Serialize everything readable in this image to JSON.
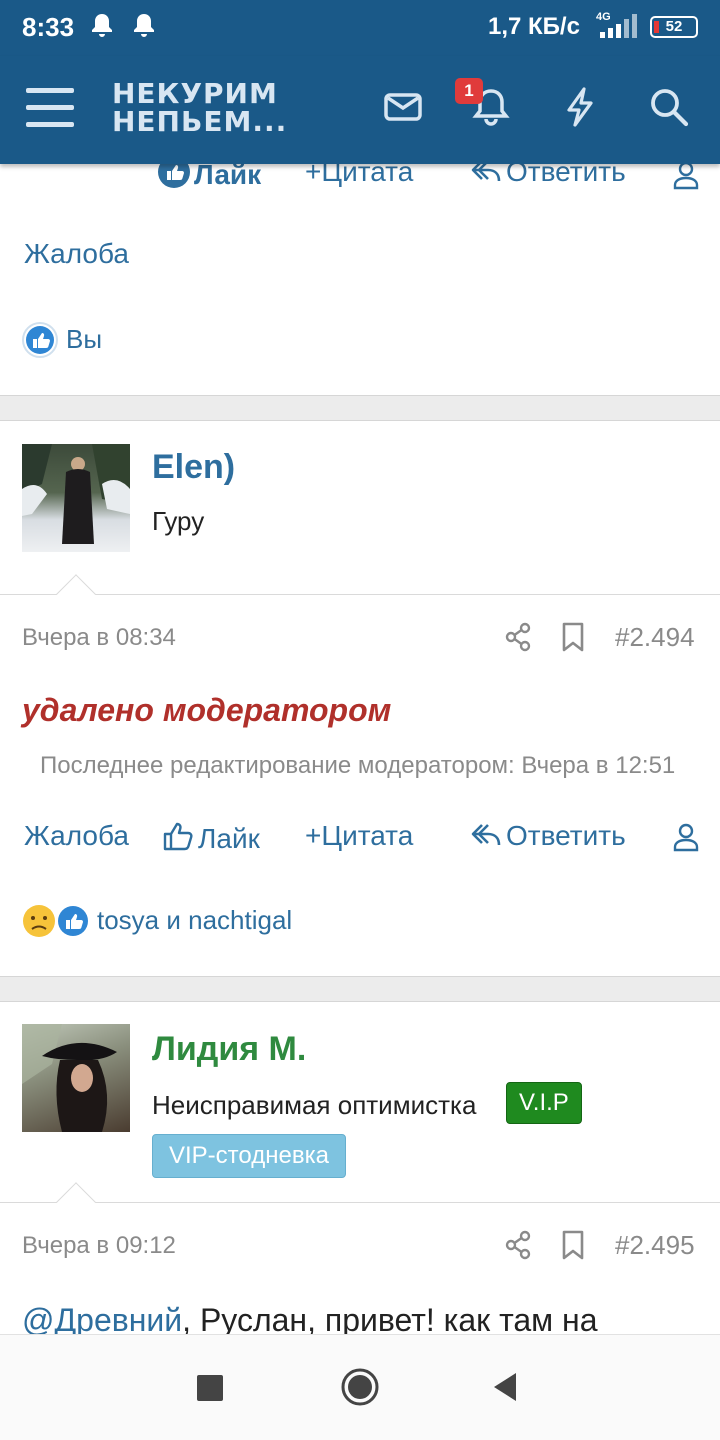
{
  "status_bar": {
    "time": "8:33",
    "speed": "1,7 КБ/с",
    "network": "4G",
    "battery": "52"
  },
  "header": {
    "logo_line1": "НЕКУРИМ",
    "logo_line2": "НЕПЬЕМ...",
    "notification_count": "1"
  },
  "prev_post": {
    "actions": {
      "like": "Лайк",
      "quote": "Цитата",
      "reply": "Ответить"
    },
    "report": "Жалоба",
    "reactions_text": "Вы"
  },
  "post1": {
    "author": "Elen)",
    "title": "Гуру",
    "date": "Вчера в 08:34",
    "number": "#2.494",
    "deleted": "удалено модератором",
    "edited": "Последнее редактирование модератором: Вчера в 12:51",
    "actions": {
      "report": "Жалоба",
      "like": "Лайк",
      "quote": "Цитата",
      "reply": "Ответить"
    },
    "reactions_text": "tosya и nachtigal"
  },
  "post2": {
    "author": "Лидия М.",
    "title": "Неисправимая оптимистка",
    "badge_vip": "V.I.P",
    "badge_banner": "VIP-стодневка",
    "date": "Вчера в 09:12",
    "number": "#2.495",
    "mention": "@Древний",
    "body": ", Руслан, привет! как там на"
  },
  "colors": {
    "header": "#1a5988",
    "link": "#2e6e9e",
    "deleted": "#b0302b",
    "vip_author": "#2f8a3f"
  }
}
